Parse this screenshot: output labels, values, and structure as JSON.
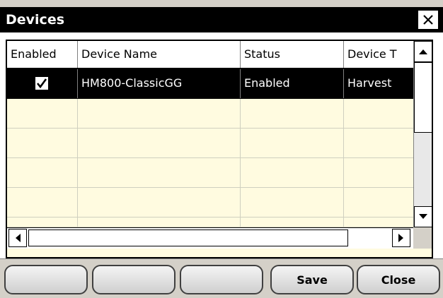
{
  "window": {
    "title": "Devices"
  },
  "table": {
    "columns": [
      "Enabled",
      "Device Name",
      "Status",
      "Device T"
    ],
    "rows": [
      {
        "enabled": true,
        "device_name": "HM800-ClassicGG",
        "status": "Enabled",
        "device_type": "Harvest"
      }
    ]
  },
  "footer": {
    "buttons": [
      "",
      "",
      "",
      "Save",
      "Close"
    ]
  },
  "icons": {
    "close": "close-icon",
    "scroll_up": "chevron-up-icon",
    "scroll_down": "chevron-down-icon",
    "scroll_left": "chevron-left-icon",
    "scroll_right": "chevron-right-icon",
    "checkbox": "checkmark-icon"
  },
  "colors": {
    "titlebar": "#000000",
    "grid_background": "#fffbe0",
    "selected_row": "#000000",
    "footer_background": "#d4d0c8"
  }
}
